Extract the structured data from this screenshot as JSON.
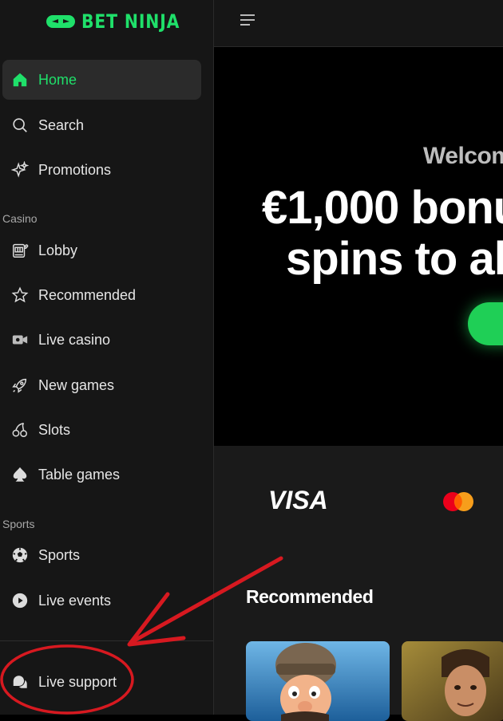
{
  "brand": {
    "name": "BET NINJA",
    "color": "#1fe06a"
  },
  "sidebar": {
    "main": [
      {
        "label": "Home",
        "icon": "home-icon",
        "active": true
      },
      {
        "label": "Search",
        "icon": "search-icon"
      },
      {
        "label": "Promotions",
        "icon": "sparkle-icon"
      }
    ],
    "casino_label": "Casino",
    "casino": [
      {
        "label": "Lobby",
        "icon": "slot-machine-icon"
      },
      {
        "label": "Recommended",
        "icon": "star-icon"
      },
      {
        "label": "Live casino",
        "icon": "video-camera-icon"
      },
      {
        "label": "New games",
        "icon": "rocket-icon"
      },
      {
        "label": "Slots",
        "icon": "cherries-icon"
      },
      {
        "label": "Table games",
        "icon": "spade-icon"
      }
    ],
    "sports_label": "Sports",
    "sports": [
      {
        "label": "Sports",
        "icon": "soccer-ball-icon"
      },
      {
        "label": "Live events",
        "icon": "play-circle-icon"
      }
    ],
    "support": {
      "label": "Live support",
      "icon": "chat-bubbles-icon"
    }
  },
  "hero": {
    "welcome": "Welcom",
    "headline_line1": "€1,000 bonu",
    "headline_line2": "spins to al"
  },
  "payments": {
    "visa": "VISA",
    "mastercard": "mastercard-logo"
  },
  "recommended": {
    "title": "Recommended"
  },
  "colors": {
    "accent": "#1fe06a",
    "sidebar_bg": "#161616",
    "annotation": "#d71920"
  }
}
